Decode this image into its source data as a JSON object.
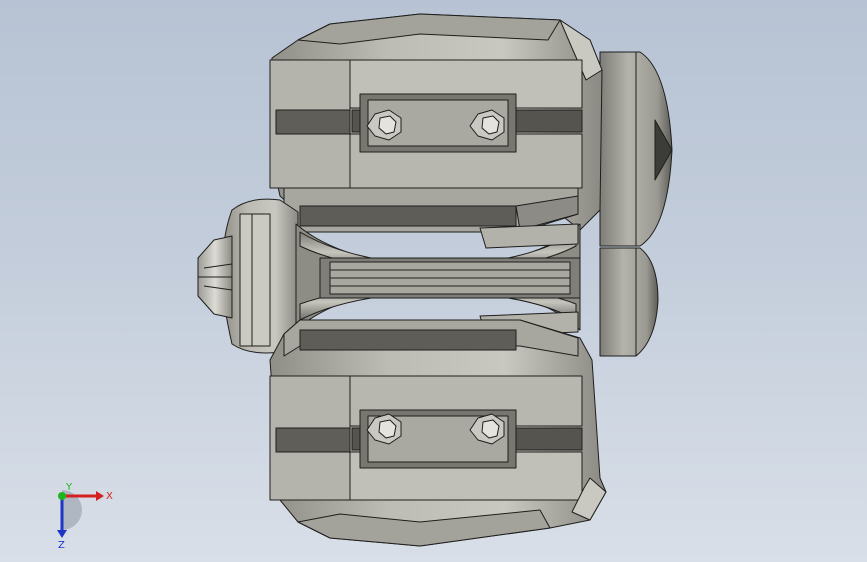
{
  "viewport": {
    "background_top": "#b7c3d4",
    "background_bottom": "#d9dfe8"
  },
  "model": {
    "body_color": "#b9b8b0",
    "light_color": "#d6d5cf",
    "shadow_color": "#707069",
    "dark_color": "#4a4a46",
    "edge_color": "#1e1e1c",
    "bolt_color": "#c9c8c2"
  },
  "triad": {
    "x_label": "X",
    "y_label": "Y",
    "z_label": "Z",
    "x_color": "#d42020",
    "y_color": "#1fb51f",
    "z_color": "#1c36c8"
  }
}
